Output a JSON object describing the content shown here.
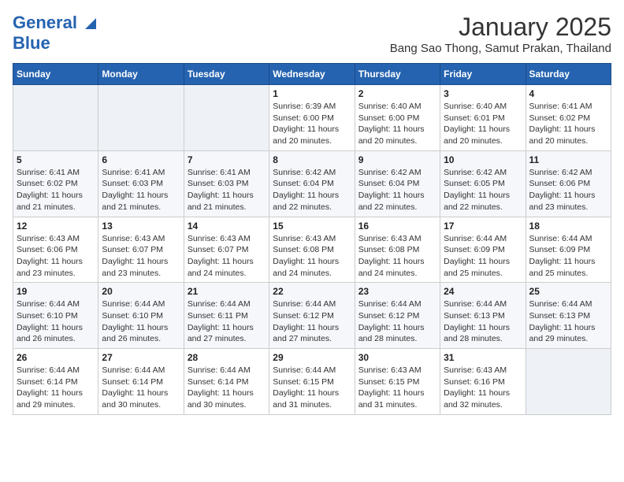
{
  "header": {
    "logo_general": "General",
    "logo_blue": "Blue",
    "title": "January 2025",
    "subtitle": "Bang Sao Thong, Samut Prakan, Thailand"
  },
  "days_of_week": [
    "Sunday",
    "Monday",
    "Tuesday",
    "Wednesday",
    "Thursday",
    "Friday",
    "Saturday"
  ],
  "weeks": [
    [
      {
        "day": "",
        "info": ""
      },
      {
        "day": "",
        "info": ""
      },
      {
        "day": "",
        "info": ""
      },
      {
        "day": "1",
        "info": "Sunrise: 6:39 AM\nSunset: 6:00 PM\nDaylight: 11 hours and 20 minutes."
      },
      {
        "day": "2",
        "info": "Sunrise: 6:40 AM\nSunset: 6:00 PM\nDaylight: 11 hours and 20 minutes."
      },
      {
        "day": "3",
        "info": "Sunrise: 6:40 AM\nSunset: 6:01 PM\nDaylight: 11 hours and 20 minutes."
      },
      {
        "day": "4",
        "info": "Sunrise: 6:41 AM\nSunset: 6:02 PM\nDaylight: 11 hours and 20 minutes."
      }
    ],
    [
      {
        "day": "5",
        "info": "Sunrise: 6:41 AM\nSunset: 6:02 PM\nDaylight: 11 hours and 21 minutes."
      },
      {
        "day": "6",
        "info": "Sunrise: 6:41 AM\nSunset: 6:03 PM\nDaylight: 11 hours and 21 minutes."
      },
      {
        "day": "7",
        "info": "Sunrise: 6:41 AM\nSunset: 6:03 PM\nDaylight: 11 hours and 21 minutes."
      },
      {
        "day": "8",
        "info": "Sunrise: 6:42 AM\nSunset: 6:04 PM\nDaylight: 11 hours and 22 minutes."
      },
      {
        "day": "9",
        "info": "Sunrise: 6:42 AM\nSunset: 6:04 PM\nDaylight: 11 hours and 22 minutes."
      },
      {
        "day": "10",
        "info": "Sunrise: 6:42 AM\nSunset: 6:05 PM\nDaylight: 11 hours and 22 minutes."
      },
      {
        "day": "11",
        "info": "Sunrise: 6:42 AM\nSunset: 6:06 PM\nDaylight: 11 hours and 23 minutes."
      }
    ],
    [
      {
        "day": "12",
        "info": "Sunrise: 6:43 AM\nSunset: 6:06 PM\nDaylight: 11 hours and 23 minutes."
      },
      {
        "day": "13",
        "info": "Sunrise: 6:43 AM\nSunset: 6:07 PM\nDaylight: 11 hours and 23 minutes."
      },
      {
        "day": "14",
        "info": "Sunrise: 6:43 AM\nSunset: 6:07 PM\nDaylight: 11 hours and 24 minutes."
      },
      {
        "day": "15",
        "info": "Sunrise: 6:43 AM\nSunset: 6:08 PM\nDaylight: 11 hours and 24 minutes."
      },
      {
        "day": "16",
        "info": "Sunrise: 6:43 AM\nSunset: 6:08 PM\nDaylight: 11 hours and 24 minutes."
      },
      {
        "day": "17",
        "info": "Sunrise: 6:44 AM\nSunset: 6:09 PM\nDaylight: 11 hours and 25 minutes."
      },
      {
        "day": "18",
        "info": "Sunrise: 6:44 AM\nSunset: 6:09 PM\nDaylight: 11 hours and 25 minutes."
      }
    ],
    [
      {
        "day": "19",
        "info": "Sunrise: 6:44 AM\nSunset: 6:10 PM\nDaylight: 11 hours and 26 minutes."
      },
      {
        "day": "20",
        "info": "Sunrise: 6:44 AM\nSunset: 6:10 PM\nDaylight: 11 hours and 26 minutes."
      },
      {
        "day": "21",
        "info": "Sunrise: 6:44 AM\nSunset: 6:11 PM\nDaylight: 11 hours and 27 minutes."
      },
      {
        "day": "22",
        "info": "Sunrise: 6:44 AM\nSunset: 6:12 PM\nDaylight: 11 hours and 27 minutes."
      },
      {
        "day": "23",
        "info": "Sunrise: 6:44 AM\nSunset: 6:12 PM\nDaylight: 11 hours and 28 minutes."
      },
      {
        "day": "24",
        "info": "Sunrise: 6:44 AM\nSunset: 6:13 PM\nDaylight: 11 hours and 28 minutes."
      },
      {
        "day": "25",
        "info": "Sunrise: 6:44 AM\nSunset: 6:13 PM\nDaylight: 11 hours and 29 minutes."
      }
    ],
    [
      {
        "day": "26",
        "info": "Sunrise: 6:44 AM\nSunset: 6:14 PM\nDaylight: 11 hours and 29 minutes."
      },
      {
        "day": "27",
        "info": "Sunrise: 6:44 AM\nSunset: 6:14 PM\nDaylight: 11 hours and 30 minutes."
      },
      {
        "day": "28",
        "info": "Sunrise: 6:44 AM\nSunset: 6:14 PM\nDaylight: 11 hours and 30 minutes."
      },
      {
        "day": "29",
        "info": "Sunrise: 6:44 AM\nSunset: 6:15 PM\nDaylight: 11 hours and 31 minutes."
      },
      {
        "day": "30",
        "info": "Sunrise: 6:43 AM\nSunset: 6:15 PM\nDaylight: 11 hours and 31 minutes."
      },
      {
        "day": "31",
        "info": "Sunrise: 6:43 AM\nSunset: 6:16 PM\nDaylight: 11 hours and 32 minutes."
      },
      {
        "day": "",
        "info": ""
      }
    ]
  ]
}
